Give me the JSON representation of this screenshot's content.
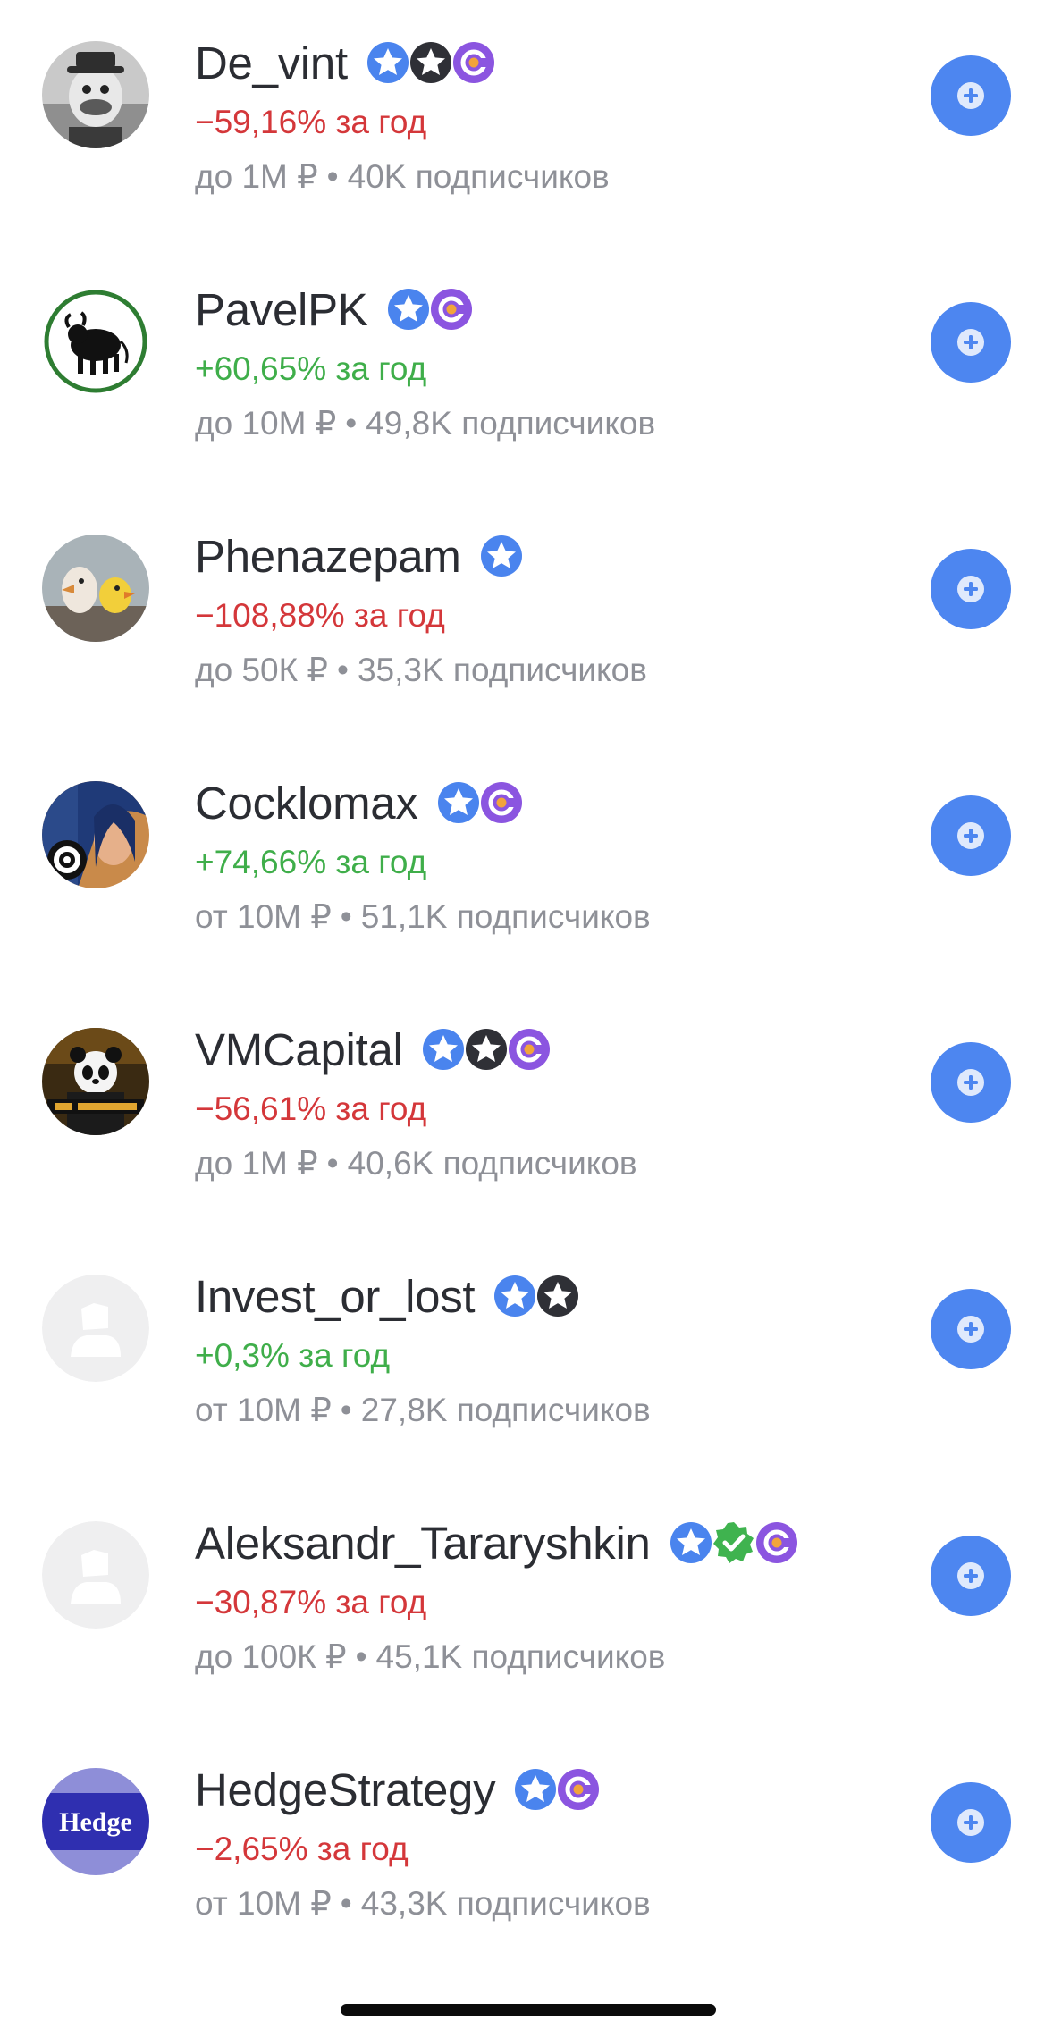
{
  "colors": {
    "positive": "#3fae4a",
    "negative": "#d4373a",
    "accent": "#4d86f0"
  },
  "authors": [
    {
      "name": "De_vint",
      "change": "−59,16% за год",
      "trend": "negative",
      "limit": "до 1М ₽",
      "subscribers": "40K подписчиков",
      "badges": [
        "star-blue-icon",
        "star-dark-icon",
        "ring-purple-icon"
      ],
      "avatar": "duck-cartoon-avatar"
    },
    {
      "name": "PavelPK",
      "change": "+60,65% за год",
      "trend": "positive",
      "limit": "до 10М ₽",
      "subscribers": "49,8K подписчиков",
      "badges": [
        "star-blue-icon",
        "ring-purple-icon"
      ],
      "avatar": "bull-logo-avatar"
    },
    {
      "name": "Phenazepam",
      "change": "−108,88% за год",
      "trend": "negative",
      "limit": "до 50К ₽",
      "subscribers": "35,3K подписчиков",
      "badges": [
        "star-blue-icon"
      ],
      "avatar": "birds-photo-avatar"
    },
    {
      "name": "Cocklomax",
      "change": "+74,66% за год",
      "trend": "positive",
      "limit": "от 10М ₽",
      "subscribers": "51,1K подписчиков",
      "badges": [
        "star-blue-icon",
        "ring-purple-icon"
      ],
      "avatar": "comic-art-avatar"
    },
    {
      "name": "VMCapital",
      "change": "−56,61% за год",
      "trend": "negative",
      "limit": "до 1М ₽",
      "subscribers": "40,6K подписчиков",
      "badges": [
        "star-blue-icon",
        "star-dark-icon",
        "ring-purple-icon"
      ],
      "avatar": "panda-avatar"
    },
    {
      "name": "Invest_or_lost",
      "change": "+0,3% за год",
      "trend": "positive",
      "limit": "от 10М ₽",
      "subscribers": "27,8K подписчиков",
      "badges": [
        "star-blue-icon",
        "star-dark-icon"
      ],
      "avatar": "placeholder-avatar"
    },
    {
      "name": "Aleksandr_Tararyshkin",
      "change": "−30,87% за год",
      "trend": "negative",
      "limit": "до 100К ₽",
      "subscribers": "45,1K подписчиков",
      "badges": [
        "star-blue-icon",
        "verified-green-icon",
        "ring-purple-icon"
      ],
      "avatar": "placeholder-avatar"
    },
    {
      "name": "HedgeStrategy",
      "change": "−2,65% за год",
      "trend": "negative",
      "limit": "от 10М ₽",
      "subscribers": "43,3K подписчиков",
      "badges": [
        "star-blue-icon",
        "ring-purple-icon"
      ],
      "avatar": "hedge-logo-avatar",
      "avatar_text": "Hedge"
    }
  ],
  "follow_icon": "plus-circle-icon",
  "separator": "•"
}
